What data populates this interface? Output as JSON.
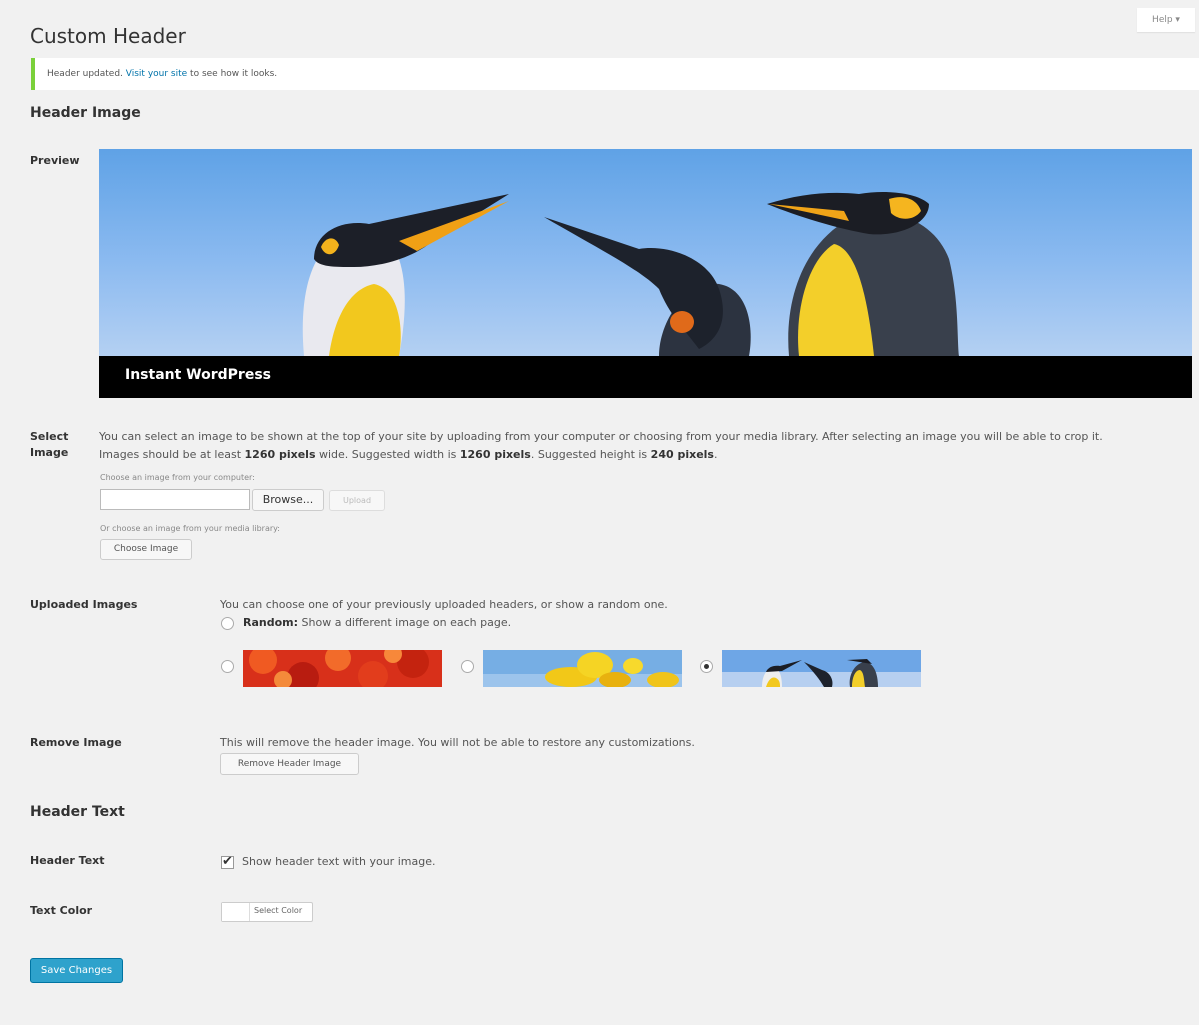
{
  "help": {
    "label": "Help ▾"
  },
  "page": {
    "title": "Custom Header"
  },
  "notice": {
    "before": "Header updated. ",
    "link": "Visit your site",
    "after": " to see how it looks."
  },
  "header_image": {
    "heading": "Header Image",
    "preview_label": "Preview",
    "preview_site_title": "Instant WordPress"
  },
  "select_image": {
    "label": "Select Image",
    "desc_line1": "You can select an image to be shown at the top of your site by uploading from your computer or choosing from your media library. After selecting an image you will be able to crop it.",
    "desc_line2_a": "Images should be at least ",
    "desc_line2_b": "1260 pixels",
    "desc_line2_c": " wide. Suggested width is ",
    "desc_line2_d": "1260 pixels",
    "desc_line2_e": ". Suggested height is ",
    "desc_line2_f": "240 pixels",
    "desc_line2_g": ".",
    "choose_from_computer": "Choose an image from your computer:",
    "browse_label": "Browse...",
    "upload_label": "Upload",
    "choose_from_library": "Or choose an image from your media library:",
    "choose_image_label": "Choose Image"
  },
  "uploaded_images": {
    "label": "Uploaded Images",
    "desc": "You can choose one of your previously uploaded headers, or show a random one.",
    "random_bold": "Random:",
    "random_text": " Show a different image on each page.",
    "selected_index": 2
  },
  "remove_image": {
    "label": "Remove Image",
    "desc": "This will remove the header image. You will not be able to restore any customizations.",
    "button_label": "Remove Header Image"
  },
  "header_text": {
    "heading": "Header Text",
    "label": "Header Text",
    "checkbox_label": "Show header text with your image.",
    "checked": true
  },
  "text_color": {
    "label": "Text Color",
    "button_label": "Select Color",
    "swatch": "#ffffff"
  },
  "save": {
    "label": "Save Changes"
  }
}
